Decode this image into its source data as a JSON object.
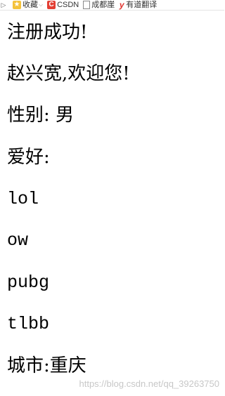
{
  "bookmarks": {
    "favorites_label": "收藏",
    "csdn_label": "CSDN",
    "item3_label": "成都崖",
    "item4_label": "有道翻译"
  },
  "page": {
    "title": "注册成功!",
    "welcome": "赵兴宽,欢迎您!",
    "gender": "性别: 男",
    "hobbies_label": "爱好:",
    "hobbies": [
      "lol",
      "ow",
      "pubg",
      "tlbb"
    ],
    "city": "城市:重庆"
  },
  "watermark": "https://blog.csdn.net/qq_39263750",
  "colors": {
    "text": "#000000",
    "background": "#ffffff",
    "csdn_brand": "#e33e33"
  }
}
